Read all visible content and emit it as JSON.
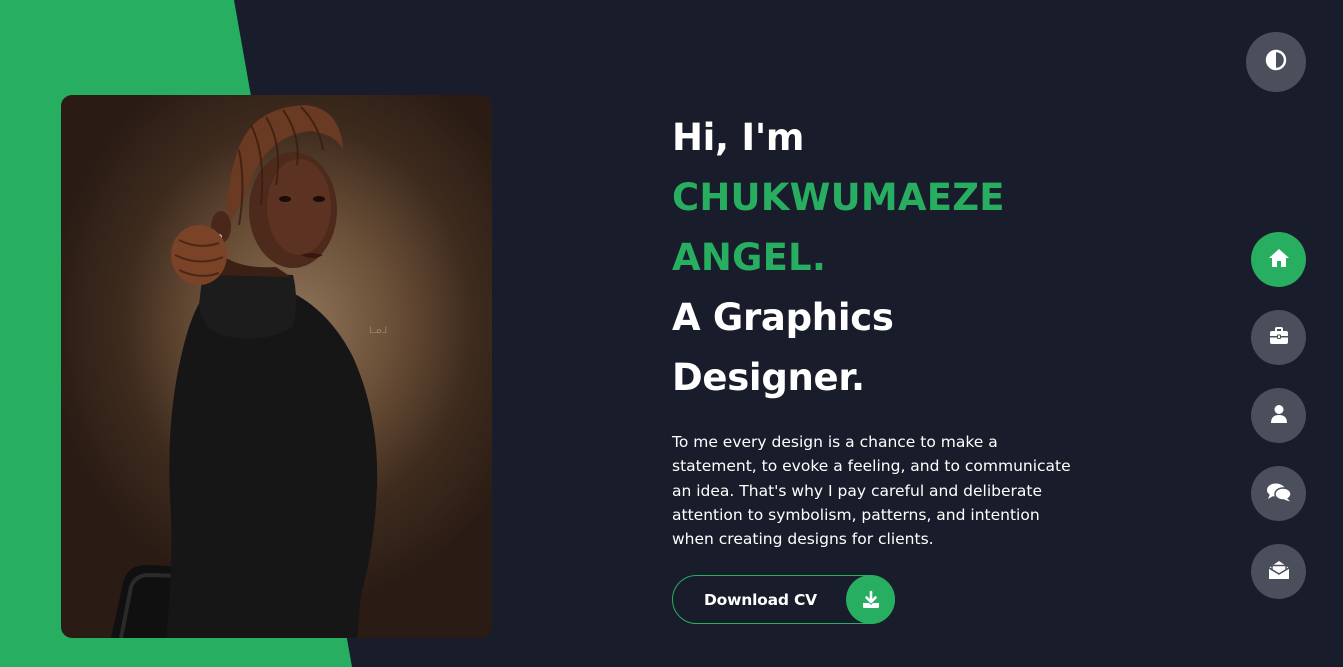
{
  "hero": {
    "greeting": "Hi, I'm",
    "name_line1": "CHUKWUMAEZE",
    "name_line2": "ANGEL.",
    "role_line1": "A Graphics",
    "role_line2": "Designer.",
    "intro": "To me every design is a chance to make a statement, to evoke a feeling, and to communicate an idea. That's why I pay careful and deliberate attention to symbolism, patterns, and intention when creating designs for clients."
  },
  "cv_button": {
    "label": "Download CV",
    "icon": "download-icon"
  },
  "theme_toggle": {
    "icon": "contrast-icon"
  },
  "nav": {
    "items": [
      {
        "icon": "home-icon",
        "active": true
      },
      {
        "icon": "briefcase-icon",
        "active": false
      },
      {
        "icon": "user-icon",
        "active": false
      },
      {
        "icon": "chat-icon",
        "active": false
      },
      {
        "icon": "envelope-open-icon",
        "active": false
      }
    ]
  },
  "colors": {
    "accent": "#27ae60",
    "background": "#191c2a",
    "button_grey": "#4a4f5b",
    "text": "#ffffff"
  }
}
